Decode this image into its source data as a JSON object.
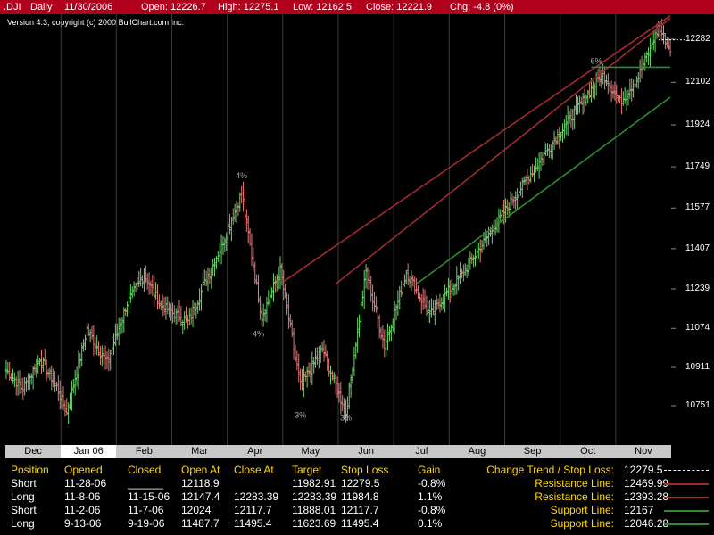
{
  "header": {
    "symbol": ".DJI",
    "period": "Daily",
    "date": "11/30/2006",
    "open": "Open: 12226.7",
    "high": "High: 12275.1",
    "low": "Low: 12162.5",
    "close": "Close: 12221.9",
    "change": "Chg: -4.8 (0%)"
  },
  "version": "Version 4.3, copyright (c) 2000 BullChart.com Inc.",
  "colors": {
    "up": "#6fd26f",
    "down": "#e07a7a",
    "resistance": "#a02a30",
    "support": "#2e8b2e",
    "title_bg": "#b0001c",
    "heading": "#ffd800"
  },
  "chart_data": {
    "type": "ohlc",
    "y_ticks": [
      12282,
      12102,
      11924,
      11749,
      11577,
      11407,
      11239,
      11074,
      10911,
      10751
    ],
    "x_ticks": [
      "Dec",
      "Jan 06",
      "Feb",
      "Mar",
      "Apr",
      "May",
      "Jun",
      "Jul",
      "Aug",
      "Sep",
      "Oct",
      "Nov"
    ],
    "selected_x": "Jan 06",
    "price_keyframes": [
      {
        "day": 0,
        "close": 10900
      },
      {
        "day": 10,
        "close": 10820
      },
      {
        "day": 20,
        "close": 10950
      },
      {
        "day": 30,
        "close": 10830
      },
      {
        "day": 36,
        "close": 10720
      },
      {
        "day": 48,
        "close": 11070
      },
      {
        "day": 60,
        "close": 10930
      },
      {
        "day": 72,
        "close": 11180
      },
      {
        "day": 82,
        "close": 11300
      },
      {
        "day": 92,
        "close": 11170
      },
      {
        "day": 108,
        "close": 11100
      },
      {
        "day": 128,
        "close": 11420
      },
      {
        "day": 140,
        "close": 11640
      },
      {
        "day": 152,
        "close": 11120
      },
      {
        "day": 163,
        "close": 11320
      },
      {
        "day": 175,
        "close": 10830
      },
      {
        "day": 188,
        "close": 10990
      },
      {
        "day": 202,
        "close": 10720
      },
      {
        "day": 214,
        "close": 11310
      },
      {
        "day": 225,
        "close": 11000
      },
      {
        "day": 238,
        "close": 11310
      },
      {
        "day": 252,
        "close": 11130
      },
      {
        "day": 272,
        "close": 11310
      },
      {
        "day": 300,
        "close": 11600
      },
      {
        "day": 330,
        "close": 11900
      },
      {
        "day": 355,
        "close": 12140
      },
      {
        "day": 365,
        "close": 12020
      },
      {
        "day": 375,
        "close": 12110
      },
      {
        "day": 388,
        "close": 12330
      },
      {
        "day": 395,
        "close": 12240
      }
    ],
    "annotations": [
      {
        "text": "4%",
        "day": 140,
        "price": 11700
      },
      {
        "text": "4%",
        "day": 150,
        "price": 11040
      },
      {
        "text": "3%",
        "day": 175,
        "price": 10700
      },
      {
        "text": "3%",
        "day": 202,
        "price": 10690
      },
      {
        "text": "6%",
        "day": 351,
        "price": 12180
      }
    ],
    "lines": [
      {
        "type": "resistance",
        "value": 12469.99,
        "from": {
          "day": 165,
          "price": 11270
        },
        "to": {
          "day": 395,
          "price": 12380
        }
      },
      {
        "type": "resistance",
        "value": 12393.28,
        "from": {
          "day": 196,
          "price": 11260
        },
        "to": {
          "day": 395,
          "price": 12370
        }
      },
      {
        "type": "support",
        "value": 12167,
        "from": {
          "day": 348,
          "price": 12165
        },
        "to": {
          "day": 395,
          "price": 12165
        }
      },
      {
        "type": "support",
        "value": 12046.28,
        "from": {
          "day": 244,
          "price": 11260
        },
        "to": {
          "day": 395,
          "price": 12040
        }
      }
    ],
    "stop_level": 12279.5
  },
  "trades": {
    "headers": [
      "Position",
      "Opened",
      "Closed",
      "Open At",
      "Close At",
      "Target",
      "Stop Loss",
      "Gain"
    ],
    "rows": [
      {
        "position": "Short",
        "opened": "11-28-06",
        "closed": "______",
        "open_at": "12118.9",
        "close_at": "",
        "target": "11982.91",
        "stop": "12279.5",
        "gain": "-0.8%"
      },
      {
        "position": "Long",
        "opened": "11-8-06",
        "closed": "11-15-06",
        "open_at": "12147.4",
        "close_at": "12283.39",
        "target": "12283.39",
        "stop": "11984.8",
        "gain": "1.1%"
      },
      {
        "position": "Short",
        "opened": "11-2-06",
        "closed": "11-7-06",
        "open_at": "12024",
        "close_at": "12117.7",
        "target": "11888.01",
        "stop": "12117.7",
        "gain": "-0.8%"
      },
      {
        "position": "Long",
        "opened": "9-13-06",
        "closed": "9-19-06",
        "open_at": "11487.7",
        "close_at": "11495.4",
        "target": "11623.69",
        "stop": "11495.4",
        "gain": "0.1%"
      }
    ]
  },
  "right_panel": [
    {
      "label": "Change Trend / Stop Loss:",
      "value": "12279.5",
      "line": "dashed"
    },
    {
      "label": "Resistance Line:",
      "value": "12469.99",
      "line": "resistance"
    },
    {
      "label": "Resistance Line:",
      "value": "12393.28",
      "line": "resistance"
    },
    {
      "label": "Support Line:",
      "value": "12167",
      "line": "support"
    },
    {
      "label": "Support Line:",
      "value": "12046.28",
      "line": "support"
    }
  ]
}
